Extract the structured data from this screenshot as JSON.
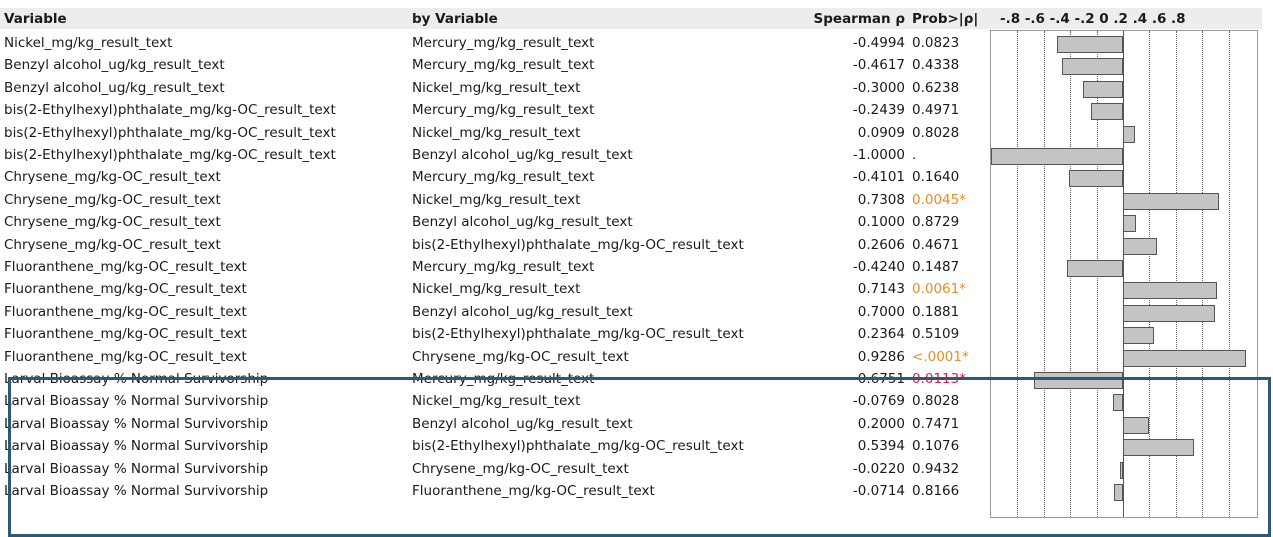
{
  "headers": {
    "variable": "Variable",
    "by_variable": "by Variable",
    "spearman": "Spearman ρ",
    "prob": "Prob>|ρ|",
    "axis_ticks": "-.8 -.6 -.4 -.2  0  .2  .4  .6  .8"
  },
  "axis": {
    "min": -1,
    "max": 1,
    "ticks": [
      -0.8,
      -0.6,
      -0.4,
      -0.2,
      0,
      0.2,
      0.4,
      0.6,
      0.8
    ]
  },
  "rows": [
    {
      "variable": "Nickel_mg/kg_result_text",
      "by": "Mercury_mg/kg_result_text",
      "rho": "-0.4994",
      "p": "0.0823",
      "sig": ""
    },
    {
      "variable": "Benzyl alcohol_ug/kg_result_text",
      "by": "Mercury_mg/kg_result_text",
      "rho": "-0.4617",
      "p": "0.4338",
      "sig": ""
    },
    {
      "variable": "Benzyl alcohol_ug/kg_result_text",
      "by": "Nickel_mg/kg_result_text",
      "rho": "-0.3000",
      "p": "0.6238",
      "sig": ""
    },
    {
      "variable": "bis(2-Ethylhexyl)phthalate_mg/kg-OC_result_text",
      "by": "Mercury_mg/kg_result_text",
      "rho": "-0.2439",
      "p": "0.4971",
      "sig": ""
    },
    {
      "variable": "bis(2-Ethylhexyl)phthalate_mg/kg-OC_result_text",
      "by": "Nickel_mg/kg_result_text",
      "rho": "0.0909",
      "p": "0.8028",
      "sig": ""
    },
    {
      "variable": "bis(2-Ethylhexyl)phthalate_mg/kg-OC_result_text",
      "by": "Benzyl alcohol_ug/kg_result_text",
      "rho": "-1.0000",
      "p": ".",
      "sig": ""
    },
    {
      "variable": "Chrysene_mg/kg-OC_result_text",
      "by": "Mercury_mg/kg_result_text",
      "rho": "-0.4101",
      "p": "0.1640",
      "sig": ""
    },
    {
      "variable": "Chrysene_mg/kg-OC_result_text",
      "by": "Nickel_mg/kg_result_text",
      "rho": "0.7308",
      "p": "0.0045*",
      "sig": "orange"
    },
    {
      "variable": "Chrysene_mg/kg-OC_result_text",
      "by": "Benzyl alcohol_ug/kg_result_text",
      "rho": "0.1000",
      "p": "0.8729",
      "sig": ""
    },
    {
      "variable": "Chrysene_mg/kg-OC_result_text",
      "by": "bis(2-Ethylhexyl)phthalate_mg/kg-OC_result_text",
      "rho": "0.2606",
      "p": "0.4671",
      "sig": ""
    },
    {
      "variable": "Fluoranthene_mg/kg-OC_result_text",
      "by": "Mercury_mg/kg_result_text",
      "rho": "-0.4240",
      "p": "0.1487",
      "sig": ""
    },
    {
      "variable": "Fluoranthene_mg/kg-OC_result_text",
      "by": "Nickel_mg/kg_result_text",
      "rho": "0.7143",
      "p": "0.0061*",
      "sig": "orange"
    },
    {
      "variable": "Fluoranthene_mg/kg-OC_result_text",
      "by": "Benzyl alcohol_ug/kg_result_text",
      "rho": "0.7000",
      "p": "0.1881",
      "sig": ""
    },
    {
      "variable": "Fluoranthene_mg/kg-OC_result_text",
      "by": "bis(2-Ethylhexyl)phthalate_mg/kg-OC_result_text",
      "rho": "0.2364",
      "p": "0.5109",
      "sig": ""
    },
    {
      "variable": "Fluoranthene_mg/kg-OC_result_text",
      "by": "Chrysene_mg/kg-OC_result_text",
      "rho": "0.9286",
      "p": "<.0001*",
      "sig": "orange"
    },
    {
      "variable": "Larval Bioassay % Normal Survivorship",
      "by": "Mercury_mg/kg_result_text",
      "rho": "-0.6751",
      "p": "0.0113*",
      "sig": "red"
    },
    {
      "variable": "Larval Bioassay % Normal Survivorship",
      "by": "Nickel_mg/kg_result_text",
      "rho": "-0.0769",
      "p": "0.8028",
      "sig": ""
    },
    {
      "variable": "Larval Bioassay % Normal Survivorship",
      "by": "Benzyl alcohol_ug/kg_result_text",
      "rho": "0.2000",
      "p": "0.7471",
      "sig": ""
    },
    {
      "variable": "Larval Bioassay % Normal Survivorship",
      "by": "bis(2-Ethylhexyl)phthalate_mg/kg-OC_result_text",
      "rho": "0.5394",
      "p": "0.1076",
      "sig": ""
    },
    {
      "variable": "Larval Bioassay % Normal Survivorship",
      "by": "Chrysene_mg/kg-OC_result_text",
      "rho": "-0.0220",
      "p": "0.9432",
      "sig": ""
    },
    {
      "variable": "Larval Bioassay % Normal Survivorship",
      "by": "Fluoranthene_mg/kg-OC_result_text",
      "rho": "-0.0714",
      "p": "0.8166",
      "sig": ""
    }
  ],
  "highlight": {
    "color": "#2c5a74"
  },
  "colors": {
    "orange": "#f08a1c",
    "red": "#e6194b",
    "bar_fill": "#c4c4c4"
  }
}
